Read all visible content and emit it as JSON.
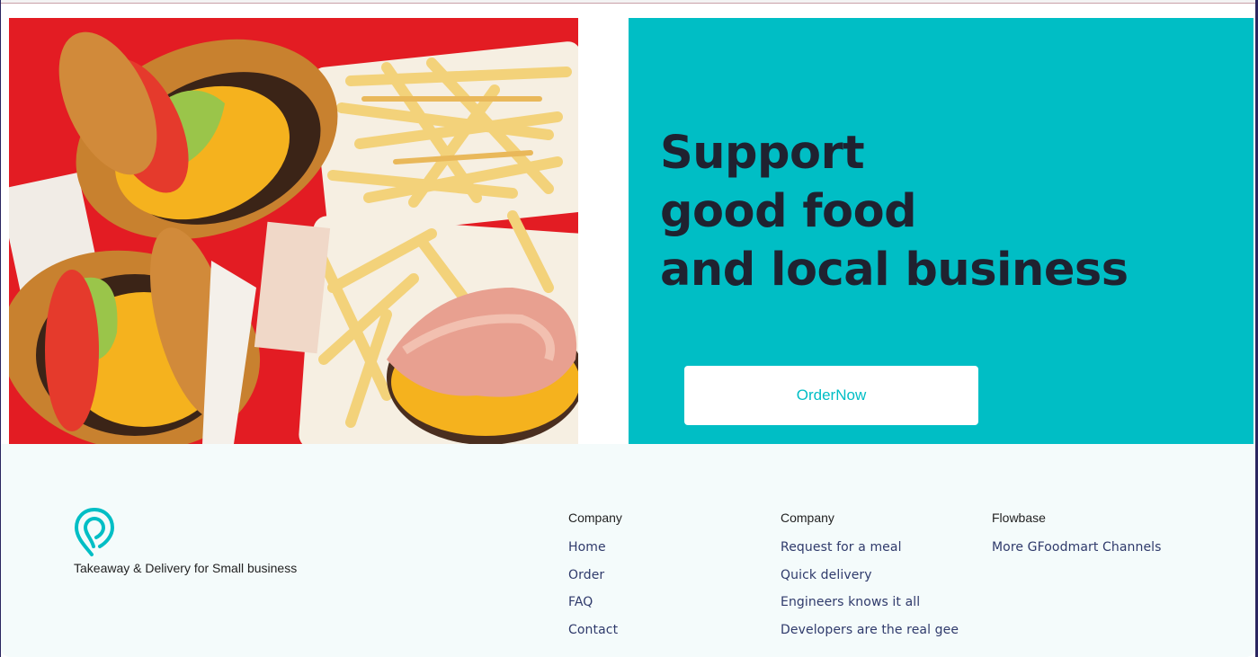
{
  "hero": {
    "title_lines": [
      "Support",
      "good food",
      "and local business"
    ],
    "order_button_label": "OrderNow",
    "image_alt": "burgers-and-fries-image"
  },
  "footer": {
    "tagline": "Takeaway & Delivery for Small business",
    "columns": [
      {
        "heading": "Company",
        "links": [
          "Home",
          "Order",
          "FAQ",
          "Contact"
        ]
      },
      {
        "heading": "Company",
        "links": [
          "Request for a meal",
          "Quick delivery",
          "Engineers knows it all",
          "Developers are the real gee"
        ]
      },
      {
        "heading": "Flowbase",
        "links": [
          "More GFoodmart Channels"
        ]
      }
    ]
  },
  "colors": {
    "accent": "#00bec5",
    "heading_text": "#1f2230",
    "footer_link": "#2f3a6b",
    "footer_bg": "#f4fbfb"
  },
  "icons": {
    "logo": "location-pin-icon"
  }
}
